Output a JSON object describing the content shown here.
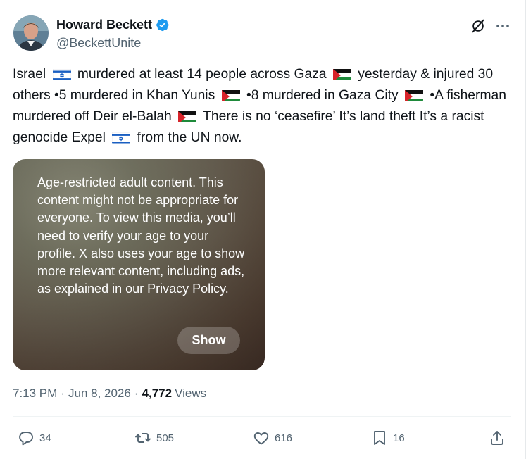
{
  "author": {
    "name": "Howard Beckett",
    "handle": "@BeckettUnite",
    "verified": true
  },
  "tweet": {
    "segments": [
      {
        "t": "Israel "
      },
      {
        "flag": "israel"
      },
      {
        "t": " murdered at least 14 people across Gaza "
      },
      {
        "flag": "palestine"
      },
      {
        "t": " yesterday & injured 30 others •5 murdered in Khan Yunis "
      },
      {
        "flag": "palestine"
      },
      {
        "t": " •8 murdered in Gaza City "
      },
      {
        "flag": "palestine"
      },
      {
        "t": " •A fisherman murdered off Deir el-Balah "
      },
      {
        "flag": "palestine"
      },
      {
        "t": " There is no ‘ceasefire’ It’s land theft It’s a racist genocide Expel "
      },
      {
        "flag": "israel"
      },
      {
        "t": " from the UN now."
      }
    ]
  },
  "media": {
    "warning_text": "Age-restricted adult content. This content might not be appropriate for everyone. To view this media, you’ll need to verify your age to your profile. X also uses your age to show more relevant content, including ads, as explained in our Privacy Policy.",
    "show_label": "Show"
  },
  "meta": {
    "time": "7:13 PM",
    "separator": "·",
    "date": "Jun 8, 2026",
    "views_count": "4,772",
    "views_label": "Views"
  },
  "actions": {
    "replies": "34",
    "reposts": "505",
    "likes": "616",
    "bookmarks": "16"
  },
  "colors": {
    "text": "#0f1419",
    "secondary": "#536471",
    "verified": "#1d9bf0",
    "divider": "#eff3f4"
  },
  "icons": {
    "verified": "verified-badge-icon",
    "grok": "grok-icon",
    "more": "more-icon",
    "reply": "reply-icon",
    "repost": "repost-icon",
    "like": "heart-icon",
    "bookmark": "bookmark-icon",
    "share": "share-icon"
  }
}
